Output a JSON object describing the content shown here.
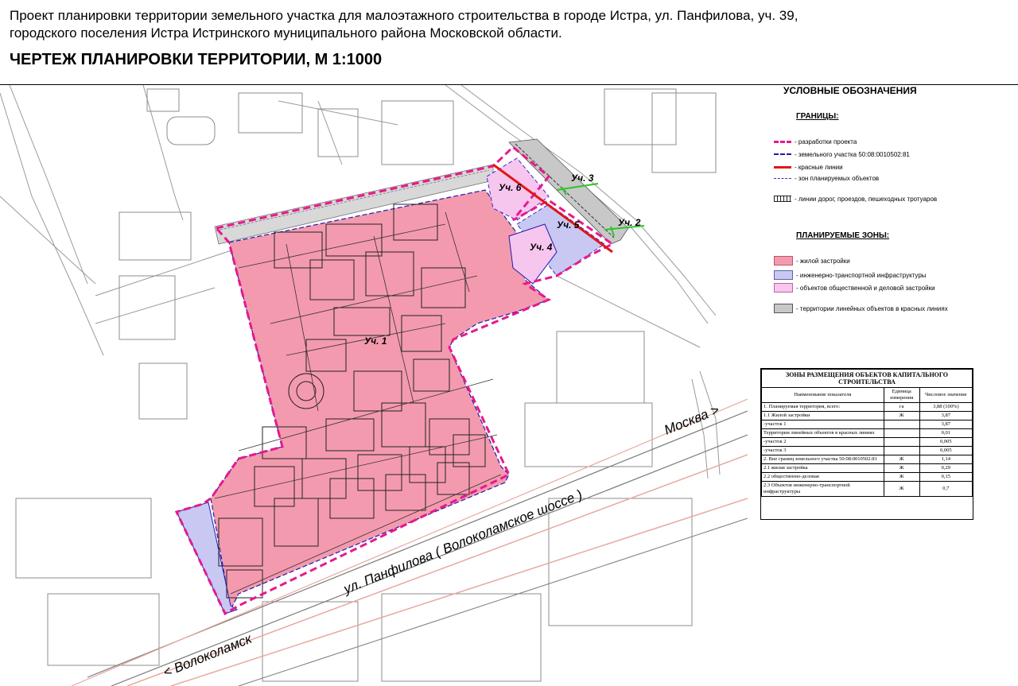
{
  "header": {
    "title_line1": "Проект планировки территории земельного участка для малоэтажного строительства в городе Истра, ул. Панфилова, уч. 39,",
    "title_line2": "городского поселения Истра Истринского муниципального района Московской области.",
    "drawing_title": "ЧЕРТЕЖ ПЛАНИРОВКИ ТЕРРИТОРИИ, М 1:1000"
  },
  "map": {
    "labels": {
      "plot1": "Уч. 1",
      "plot2": "Уч. 2",
      "plot3": "Уч. 3",
      "plot4": "Уч. 4",
      "plot5": "Уч. 5",
      "plot6": "Уч. 6",
      "street": "ул. Панфилова ( Волоколамское шоссе )",
      "to_moscow": "Москва  >",
      "to_volokolamsk": "< Волоколамск"
    }
  },
  "legend": {
    "title": "УСЛОВНЫЕ ОБОЗНАЧЕНИЯ",
    "boundaries_title": "ГРАНИЦЫ:",
    "boundaries": [
      {
        "label": "- разработки проекта",
        "color": "#e8198c"
      },
      {
        "label": "- земельного участка 50:08:0010502:81",
        "color": "#1c1cb0"
      },
      {
        "label": "- красные линии",
        "color": "#e01818"
      },
      {
        "label": "- зон планируемых объектов",
        "color": "#3a2ad0"
      },
      {
        "label": "- линии дорог, проездов, пешеходных тротуаров",
        "color": "#222222"
      }
    ],
    "zones_title": "ПЛАНИРУЕМЫЕ ЗОНЫ:",
    "zones": [
      {
        "label": "- жилой застройки",
        "color": "#f49aae"
      },
      {
        "label": "- инженерно-транспортной инфраструктуры",
        "color": "#c8c8f2"
      },
      {
        "label": "- объектов общественной и деловой застройки",
        "color": "#f7c6ee"
      },
      {
        "label": "- территории линейных объектов в красных линиях",
        "color": "#c8c8c8"
      }
    ]
  },
  "table": {
    "caption": "ЗОНЫ РАЗМЕЩЕНИЯ ОБЪЕКТОВ КАПИТАЛЬНОГО СТРОИТЕЛЬСТВА",
    "headers": [
      "Наименование показателя",
      "Единица измерения",
      "Числовое значение"
    ],
    "rows": [
      [
        "1. Планируемая территория, всего:",
        "га",
        "3,88 (100%)"
      ],
      [
        "1.1 Жилой   застройки",
        "Ж",
        "3,87"
      ],
      [
        "-участок 1",
        "",
        "3,87"
      ],
      [
        "Территории линейных объектов в красных линиях",
        "",
        "0,01"
      ],
      [
        "-участок 2",
        "",
        "0,005"
      ],
      [
        "-участок 3",
        "",
        "0,005"
      ],
      [
        "2. Вне границ земельного участка 50:08:0010502:81",
        "Ж",
        "1,14"
      ],
      [
        "2.1 жилая застройка",
        "Ж",
        "0,29"
      ],
      [
        "2.2 общественно-деловая",
        "Ж",
        "0,15"
      ],
      [
        "2.3 Объектов инженерно-транспортной инфраструктуры",
        "Ж",
        "0,7"
      ]
    ]
  }
}
